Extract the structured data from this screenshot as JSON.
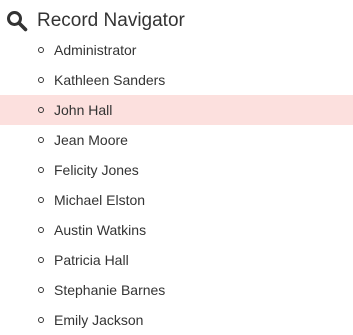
{
  "header": {
    "title": "Record Navigator",
    "icon": "search-icon"
  },
  "colors": {
    "selected_background": "#fce0de",
    "text": "#333333"
  },
  "records": [
    {
      "name": "Administrator",
      "selected": false
    },
    {
      "name": "Kathleen Sanders",
      "selected": false
    },
    {
      "name": "John Hall",
      "selected": true
    },
    {
      "name": "Jean Moore",
      "selected": false
    },
    {
      "name": "Felicity Jones",
      "selected": false
    },
    {
      "name": "Michael Elston",
      "selected": false
    },
    {
      "name": "Austin Watkins",
      "selected": false
    },
    {
      "name": "Patricia Hall",
      "selected": false
    },
    {
      "name": "Stephanie Barnes",
      "selected": false
    },
    {
      "name": "Emily Jackson",
      "selected": false
    }
  ]
}
